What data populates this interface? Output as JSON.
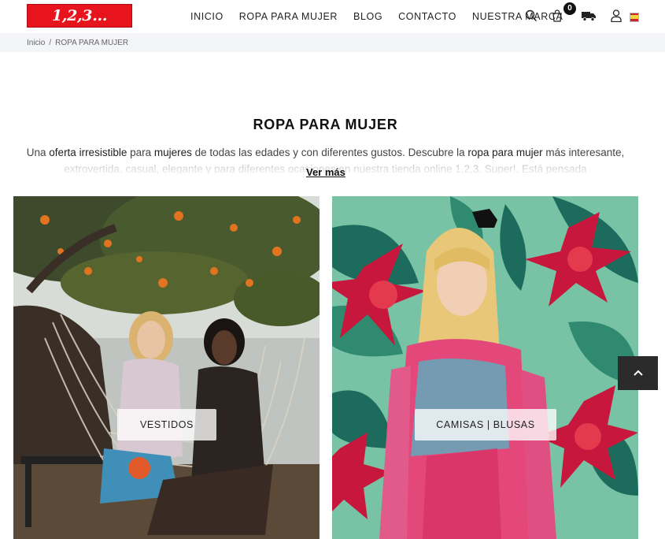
{
  "header": {
    "logo_text": "1,2,3... Super!",
    "nav": [
      "INICIO",
      "ROPA PARA MUJER",
      "BLOG",
      "CONTACTO",
      "NUESTRA MARCA"
    ],
    "cart_count": "0",
    "icons": [
      "search-icon",
      "cart-icon",
      "truck-icon",
      "user-icon",
      "language-flag-icon"
    ]
  },
  "breadcrumb": {
    "home": "Inicio",
    "separator": "/",
    "current": "ROPA PARA MUJER"
  },
  "main": {
    "title": "ROPA PARA MUJER",
    "description_parts": [
      "Una ",
      "oferta irresistible",
      " para ",
      "mujeres",
      " de todas las edades y con diferentes gustos. Descubre la ",
      "ropa para mujer",
      " más interesante, extrovertida, casual, elegante y para diferentes ocasiones en nuestra tienda online 1,2,3. Super!. Está pensada"
    ],
    "read_more": "Ver más"
  },
  "categories": [
    {
      "label": "VESTIDOS"
    },
    {
      "label": "CAMISAS | BLUSAS"
    }
  ],
  "colors": {
    "brand_red": "#e8141d",
    "breadcrumb_bg": "#f4f5f8",
    "scroll_top_bg": "#2b2b2b"
  }
}
